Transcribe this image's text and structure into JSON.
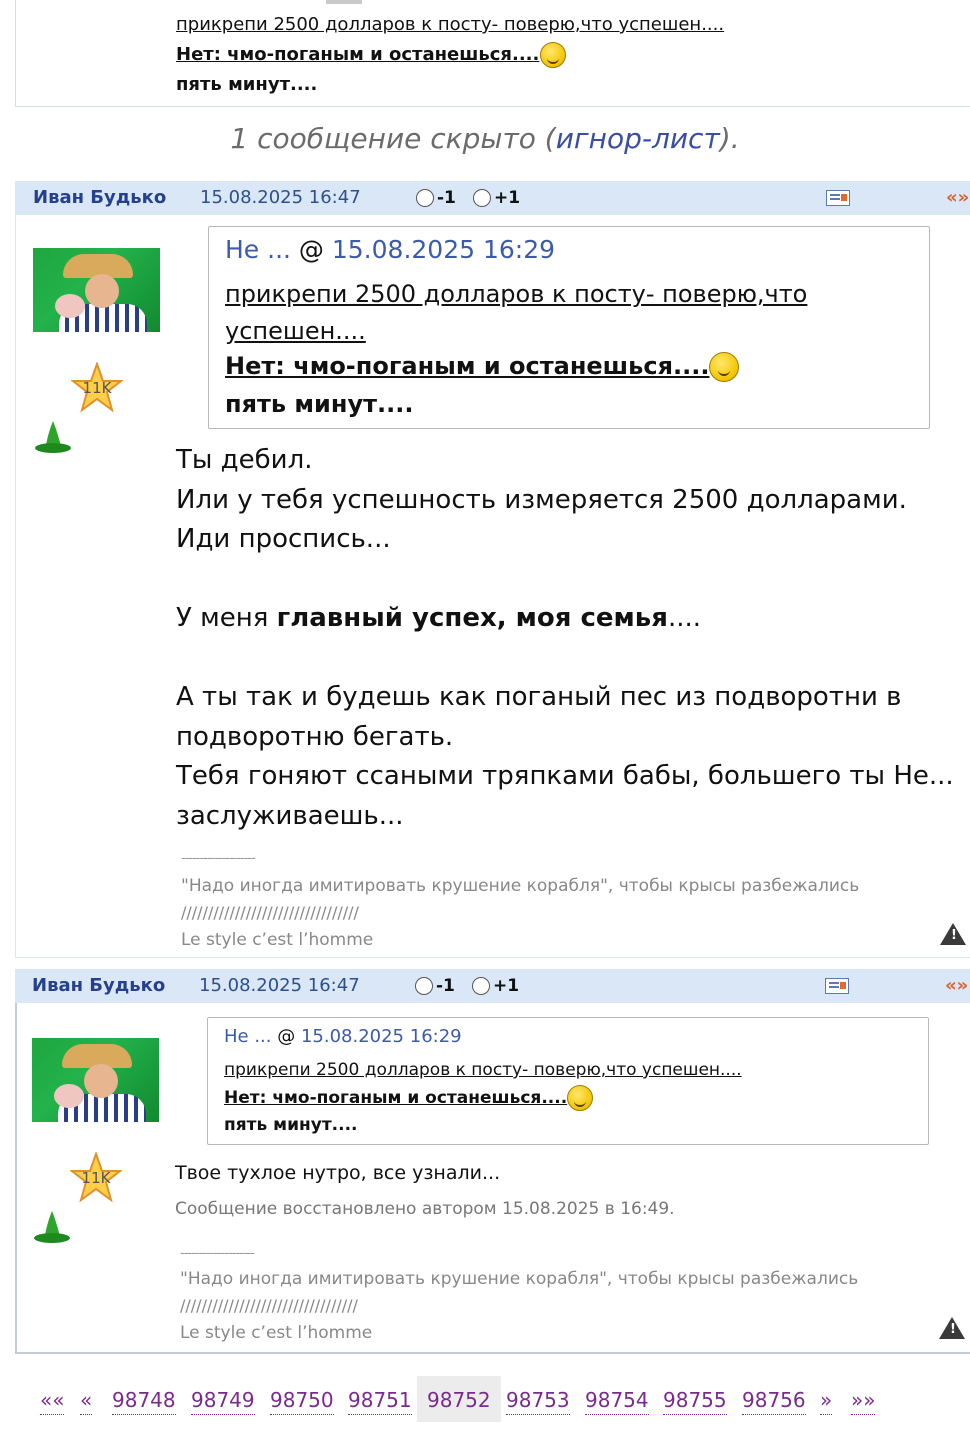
{
  "top_post": {
    "line1": "прикрепи 2500 долларов к посту- поверю,что успешен....",
    "line2": "Нет: чмо-поганым и останешься....",
    "line3": "пять минут...."
  },
  "hidden_notice": {
    "prefix": "1 сообщение скрыто (",
    "link": "игнор-лист",
    "suffix": ")."
  },
  "post1": {
    "author": "Иван Будько",
    "date": "15.08.2025 16:47",
    "vote_minus": "-1",
    "vote_plus": "+1",
    "reply": "«»",
    "rank_badge": "11K",
    "quote_head_author": "Не ...",
    "quote_head_at": " @ ",
    "quote_head_date": "15.08.2025 16:29",
    "quote_line1a": "прикрепи 2500 долларов к посту- поверю,что",
    "quote_line1b": "успешен....",
    "quote_line2": "Нет: чмо-поганым и останешься....",
    "quote_line3": "пять минут....",
    "body_line1": "Ты дебил.",
    "body_line2": "Или у тебя успешность измеряется 2500 долларами.",
    "body_line3": "Иди проспись...",
    "body_line4_pre": "У меня ",
    "body_line4_bold": "главный успех, моя семья",
    "body_line4_post": "....",
    "body_line5": "А ты так и будешь как поганый пес из подворотни в",
    "body_line6": "подворотню бегать.",
    "body_line7": "Тебя гоняют ссаными тряпками бабы, большего ты Не...",
    "body_line8": "заслуживаешь...",
    "sig_dash": "--------------------",
    "sig_quote": "\"Надо иногда имитировать крушение корабля\", чтобы крысы разбежались",
    "sig_slashes": "/////////////////////////////////",
    "sig_motto": "Le style c’est l’homme"
  },
  "post2": {
    "author": "Иван Будько",
    "date": "15.08.2025 16:47",
    "vote_minus": "-1",
    "vote_plus": "+1",
    "reply": "«»",
    "rank_badge": "11K",
    "quote_head_author": "Не ...",
    "quote_head_at": " @ ",
    "quote_head_date": "15.08.2025 16:29",
    "quote_line1": "прикрепи 2500 долларов к посту- поверю,что успешен....",
    "quote_line2": "Нет: чмо-поганым и останешься....",
    "quote_line3": "пять минут....",
    "body_line1": "Твое тухлое нутро, все узнали...",
    "restored": "Сообщение восстановлено автором 15.08.2025 в 16:49.",
    "sig_dash": "--------------------",
    "sig_quote": "\"Надо иногда имитировать крушение корабля\", чтобы крысы разбежались",
    "sig_slashes": "/////////////////////////////////",
    "sig_motto": "Le style c’est l’homme"
  },
  "pager": {
    "first": "««",
    "prev": "«",
    "pages": [
      "98748",
      "98749",
      "98750",
      "98751",
      "98752",
      "98753",
      "98754",
      "98755",
      "98756"
    ],
    "current": "98752",
    "next": "»",
    "last": "»»"
  }
}
